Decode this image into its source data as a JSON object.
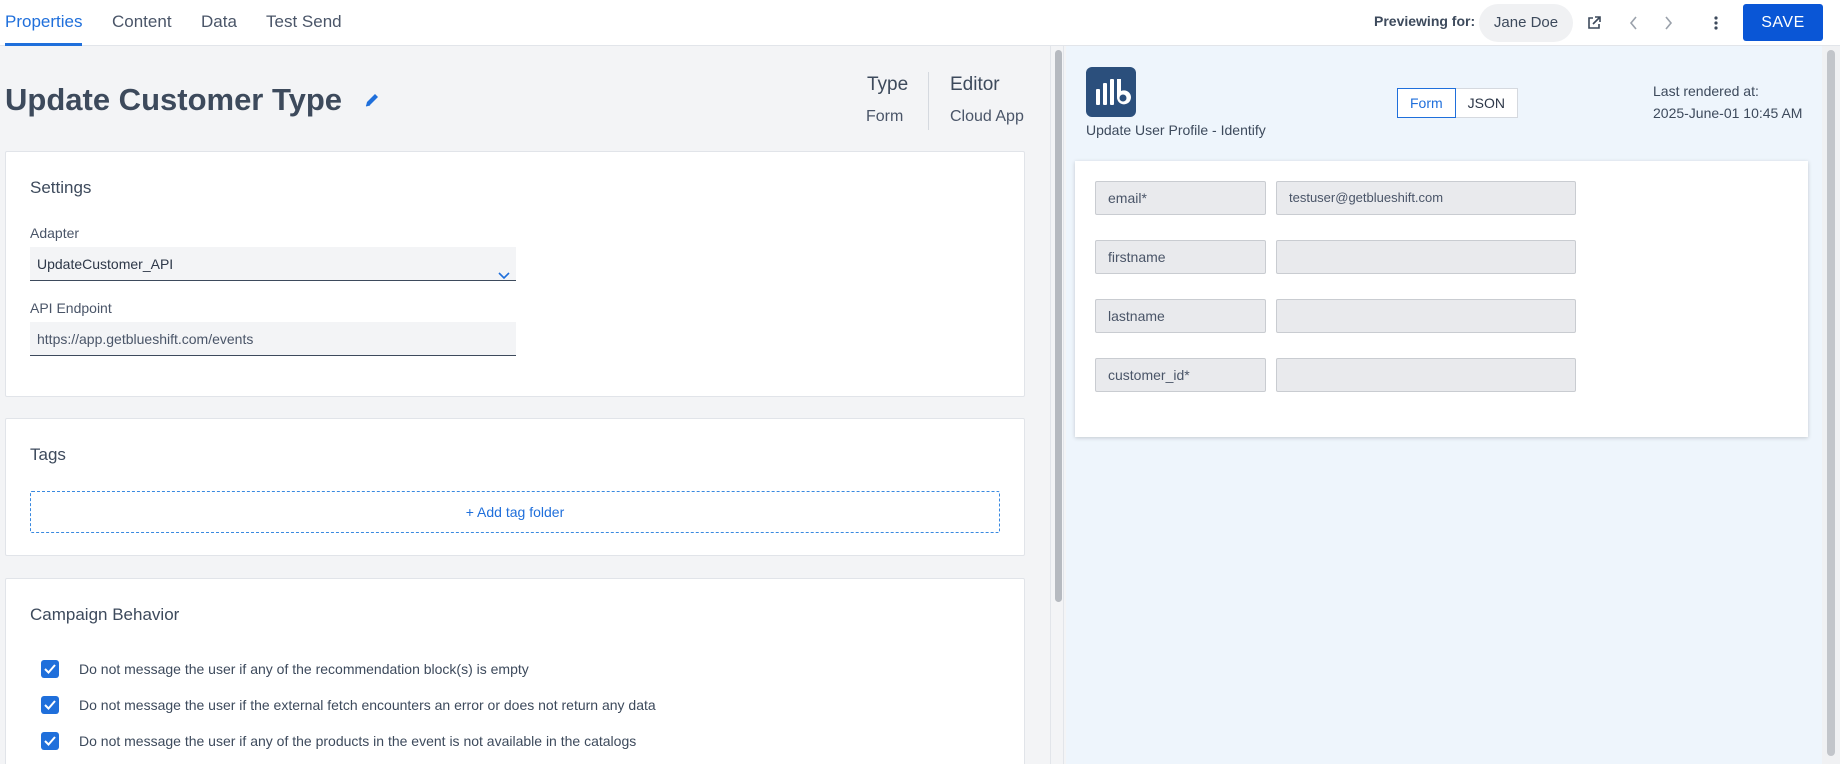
{
  "tabs": [
    {
      "label": "Properties",
      "active": true
    },
    {
      "label": "Content",
      "active": false
    },
    {
      "label": "Data",
      "active": false
    },
    {
      "label": "Test Send",
      "active": false
    }
  ],
  "toolbar": {
    "previewing_label": "Previewing for:",
    "preview_user": "Jane Doe",
    "save_label": "SAVE",
    "icons": [
      "external-link-icon",
      "chevron-left-icon",
      "chevron-right-icon",
      "more-vertical-icon"
    ]
  },
  "header": {
    "title": "Update Customer Type",
    "type_heading": "Type",
    "type_value": "Form",
    "editor_heading": "Editor",
    "editor_value": "Cloud App"
  },
  "settings": {
    "title": "Settings",
    "adapter_label": "Adapter",
    "adapter_value": "UpdateCustomer_API",
    "endpoint_label": "API Endpoint",
    "endpoint_value": "https://app.getblueshift.com/events"
  },
  "tags": {
    "title": "Tags",
    "add_label": "+ Add tag folder"
  },
  "campaign_behavior": {
    "title": "Campaign Behavior",
    "options": [
      {
        "label": "Do not message the user if any of the recommendation block(s) is empty",
        "checked": true
      },
      {
        "label": "Do not message the user if the external fetch encounters an error or does not return any data",
        "checked": true
      },
      {
        "label": "Do not message the user if any of the products in the event is not available in the catalogs",
        "checked": true
      }
    ]
  },
  "preview": {
    "template_name": "Update User Profile - Identify",
    "toggle": {
      "form": "Form",
      "json": "JSON",
      "selected": "Form"
    },
    "rendered_label": "Last rendered at:",
    "rendered_value": "2025-June-01 10:45 AM",
    "fields": [
      {
        "key": "email*",
        "value": "testuser@getblueshift.com"
      },
      {
        "key": "firstname",
        "value": ""
      },
      {
        "key": "lastname",
        "value": ""
      },
      {
        "key": "customer_id*",
        "value": ""
      }
    ]
  },
  "colors": {
    "accent": "#1f6fdb",
    "save_button": "#0a56d6",
    "logo_bg": "#2b4f7c",
    "preview_bg": "#eef5fc"
  }
}
